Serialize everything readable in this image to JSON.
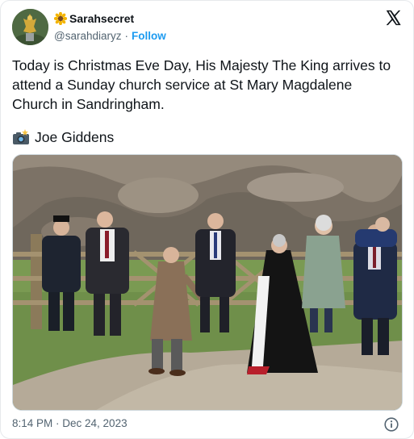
{
  "author": {
    "display_name": "Sarahsecret",
    "handle": "@sarahdiaryz",
    "separator": "·",
    "follow_label": "Follow",
    "name_emoji": "sunflower-icon"
  },
  "tweet": {
    "text": "Today is Christmas Eve Day, His Majesty The King arrives to attend a Sunday church service at St Mary Magdalene Church in Sandringham.",
    "credit_icon": "camera-flash-icon",
    "credit_text": "Joe Giddens"
  },
  "footer": {
    "timestamp": "8:14 PM · Dec 24, 2023"
  },
  "colors": {
    "link": "#1d9bf0",
    "secondary_text": "#536471",
    "primary_text": "#0f1419",
    "border": "#cfd9de"
  }
}
